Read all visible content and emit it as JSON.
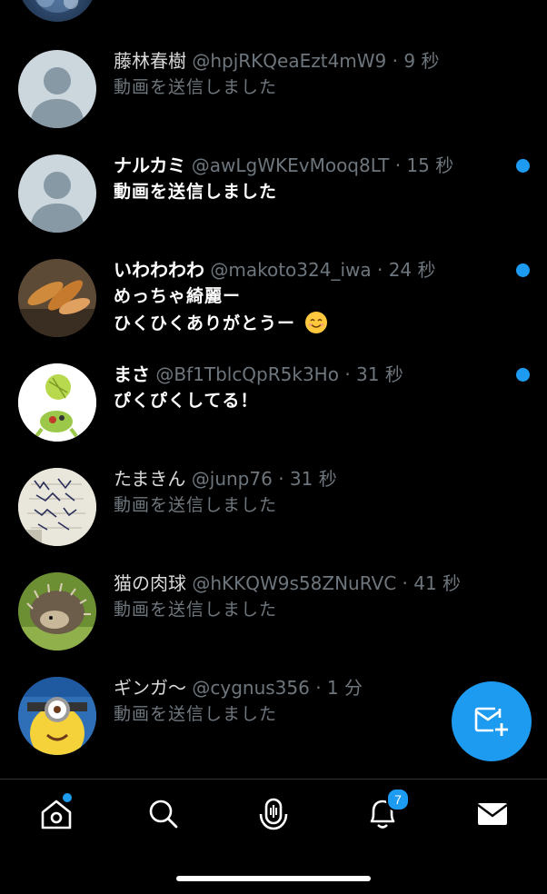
{
  "conversations": [
    {
      "name": "藤林春樹",
      "handle": "@hpjRKQeaEzt4mW9",
      "separator": "·",
      "time": "9 秒",
      "message": "動画を送信しました",
      "unread": false,
      "avatar_icon": "default-avatar"
    },
    {
      "name": "ナルカミ",
      "handle": "@awLgWKEvMooq8LT",
      "separator": "·",
      "time": "15 秒",
      "message": "動画を送信しました",
      "unread": true,
      "avatar_icon": "default-avatar"
    },
    {
      "name": "いわわわわ",
      "handle": "@makoto324_iwa",
      "separator": "·",
      "time": "24 秒",
      "message_line1": "めっちゃ綺麗ー",
      "message_line2": "ひくひくありがとうー",
      "message_emoji": "smiling-face-emoji",
      "unread": true,
      "avatar_icon": "bread-photo"
    },
    {
      "name": "まさ",
      "handle": "@Bf1TblcQpR5k3Ho",
      "separator": "·",
      "time": "31 秒",
      "message": "ぴくぴくしてる！",
      "unread": true,
      "avatar_icon": "green-cartoon-photo"
    },
    {
      "name": "たまきん",
      "handle": "@junp76",
      "separator": "·",
      "time": "31 秒",
      "message": "動画を送信しました",
      "unread": false,
      "avatar_icon": "handwritten-note-photo"
    },
    {
      "name": "猫の肉球",
      "handle": "@hKKQW9s58ZNuRVC",
      "separator": "·",
      "time": "41 秒",
      "message": "動画を送信しました",
      "unread": false,
      "avatar_icon": "hedgehog-photo"
    },
    {
      "name": "ギンガ〜",
      "handle": "@cygnus356",
      "separator": "·",
      "time": "1 分",
      "message": "動画を送信しました",
      "unread": false,
      "avatar_icon": "minion-photo"
    }
  ],
  "fab": {
    "icon": "new-message-icon"
  },
  "tabbar": {
    "tabs": [
      {
        "icon": "home-icon",
        "has_dot": true
      },
      {
        "icon": "search-icon"
      },
      {
        "icon": "spaces-icon"
      },
      {
        "icon": "notifications-bell-icon",
        "badge": "7"
      },
      {
        "icon": "messages-envelope-icon"
      }
    ]
  },
  "colors": {
    "background": "#000000",
    "accent": "#1d9bf0",
    "secondary_text": "#6e767d",
    "divider": "#2f3336"
  }
}
